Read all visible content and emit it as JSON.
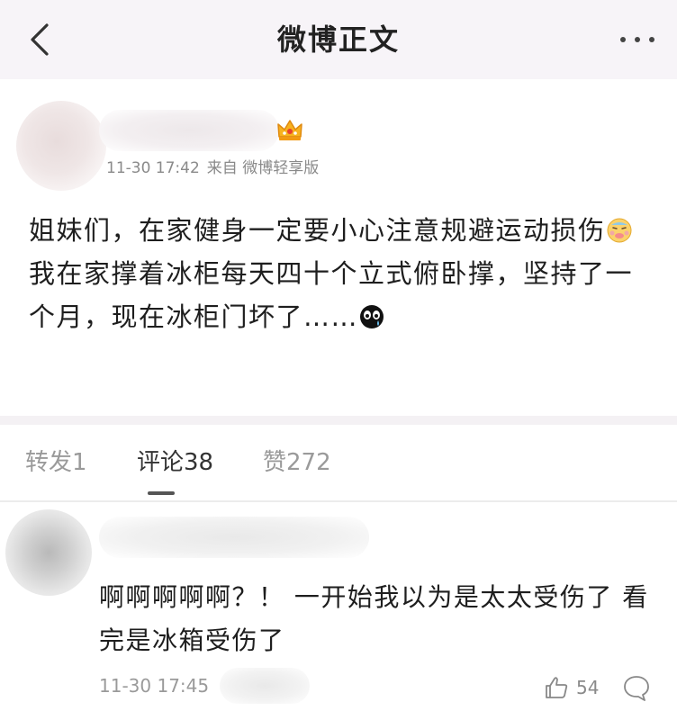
{
  "header": {
    "title": "微博正文",
    "back_icon": "chevron-left-icon",
    "more_icon": "more-dots-icon"
  },
  "post": {
    "time": "11-30 17:42",
    "source": "来自 微博轻享版",
    "badge_icon": "crown-icon",
    "body_line1_text": "姐妹们，在家健身一定要小心注意规避运动损伤",
    "body_line1_emoji": "sick-face-emoji",
    "body_line2_text": "我在家撑着冰柜每天四十个立式俯卧撑，坚持了一个月，现在冰柜门坏了……",
    "body_line2_emoji": "teary-face-emoji"
  },
  "tabs": [
    {
      "label": "转发1",
      "active": false
    },
    {
      "label": "评论38",
      "active": true
    },
    {
      "label": "赞272",
      "active": false
    }
  ],
  "comment": {
    "text": "啊啊啊啊啊？！ 一开始我以为是太太受伤了 看完是冰箱受伤了",
    "time": "11-30 17:45",
    "likes": "54",
    "like_icon": "thumbs-up-icon",
    "reply_icon": "comment-bubble-icon"
  },
  "colors": {
    "header_bg": "#f7f4f8",
    "meta_text": "#8a8a8a",
    "body_text": "#1e1e1e",
    "badge": "#f2a31b"
  }
}
